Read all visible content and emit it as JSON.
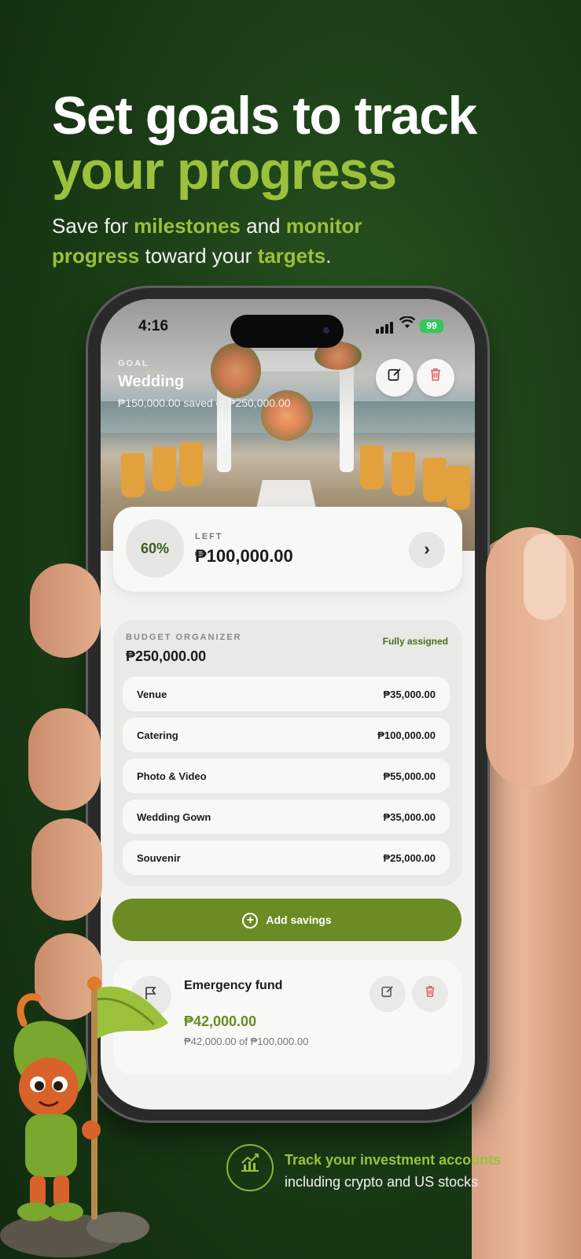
{
  "headline": {
    "line1": "Set goals to track",
    "line2": "your progress",
    "sub_a": "Save for ",
    "sub_b": "milestones",
    "sub_c": " and ",
    "sub_d": "monitor",
    "sub_e": "progress",
    "sub_f": " toward your ",
    "sub_g": "targets",
    "sub_h": "."
  },
  "status_bar": {
    "time": "4:16",
    "battery": "99"
  },
  "goal": {
    "label": "GOAL",
    "title": "Wedding",
    "saved_text": "₱150,000.00 saved of ₱250,000.00",
    "progress_percent": 60,
    "progress_label": "60%",
    "left_label": "LEFT",
    "left_amount": "₱100,000.00"
  },
  "budget_organizer": {
    "label": "BUDGET ORGANIZER",
    "total": "₱250,000.00",
    "status": "Fully assigned",
    "items": [
      {
        "name": "Venue",
        "amount": "₱35,000.00"
      },
      {
        "name": "Catering",
        "amount": "₱100,000.00"
      },
      {
        "name": "Photo & Video",
        "amount": "₱55,000.00"
      },
      {
        "name": "Wedding Gown",
        "amount": "₱35,000.00"
      },
      {
        "name": "Souvenir",
        "amount": "₱25,000.00"
      }
    ]
  },
  "add_savings_label": "Add savings",
  "emergency_fund": {
    "title": "Emergency fund",
    "amount": "₱42,000.00",
    "sub": "₱42,000.00 of ₱100,000.00"
  },
  "feature": {
    "line1": "Track your investment accounts",
    "line2": "including crypto and US stocks"
  },
  "colors": {
    "accent": "#9bc13c",
    "button": "#6d8b24",
    "background": "#1d3f18",
    "delete": "#e05a5a"
  },
  "icons": [
    "edit-icon",
    "trash-icon",
    "chevron-right-icon",
    "plus-circle-icon",
    "flag-icon",
    "chart-growth-icon",
    "wifi-icon",
    "signal-icon",
    "battery-icon"
  ]
}
